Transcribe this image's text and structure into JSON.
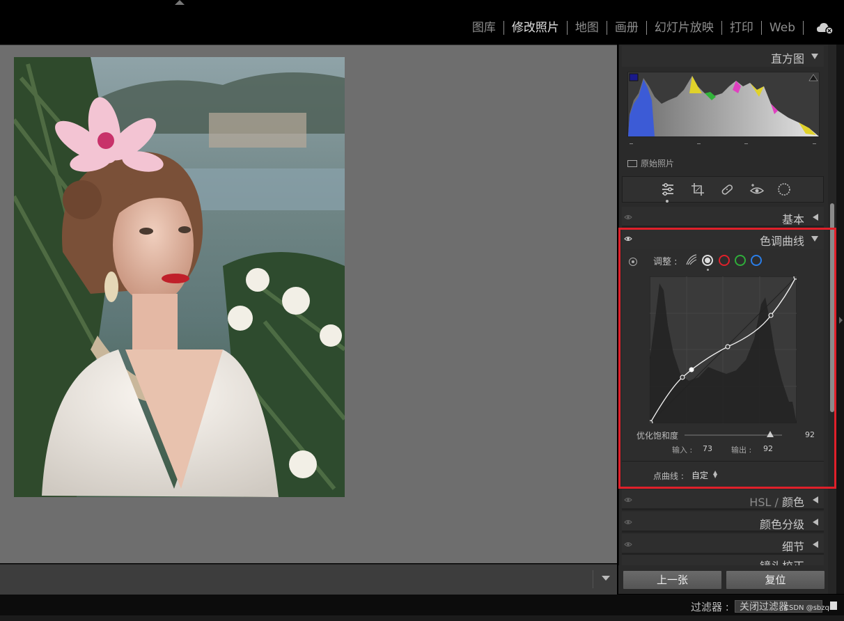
{
  "modules": [
    {
      "label": "图库",
      "active": false
    },
    {
      "label": "修改照片",
      "active": true
    },
    {
      "label": "地图",
      "active": false
    },
    {
      "label": "画册",
      "active": false
    },
    {
      "label": "幻灯片放映",
      "active": false
    },
    {
      "label": "打印",
      "active": false
    },
    {
      "label": "Web",
      "active": false
    }
  ],
  "right_panel": {
    "histogram": {
      "title": "直方图",
      "original_photo_label": "原始照片"
    },
    "basic": {
      "title": "基本"
    },
    "tone_curve": {
      "title": "色调曲线",
      "adjust_label": "调整 :",
      "channel_colors": {
        "rgb": "#dddddd",
        "red": "#e0202a",
        "green": "#2fae3a",
        "blue": "#2a7ee8"
      },
      "saturation": {
        "label": "优化饱和度",
        "value": "92",
        "level_percent": 88
      },
      "input": {
        "label": "输入 :",
        "value": "73"
      },
      "output": {
        "label": "输出 :",
        "value": "92"
      },
      "point_curve": {
        "label": "点曲线 :",
        "value": "自定"
      }
    },
    "hsl": {
      "title_a": "HSL",
      "sep": "/",
      "title_b": "颜色"
    },
    "color_grading": {
      "title": "颜色分级"
    },
    "detail": {
      "title": "细节"
    },
    "lens": {
      "title": "镜头校正"
    },
    "buttons": {
      "prev": "上一张",
      "reset": "复位"
    }
  },
  "filter_bar": {
    "label": "过滤器 :",
    "value": "关闭过滤器"
  },
  "watermark": "CSDN @sbzqr",
  "highlight_color": "#e0202a"
}
